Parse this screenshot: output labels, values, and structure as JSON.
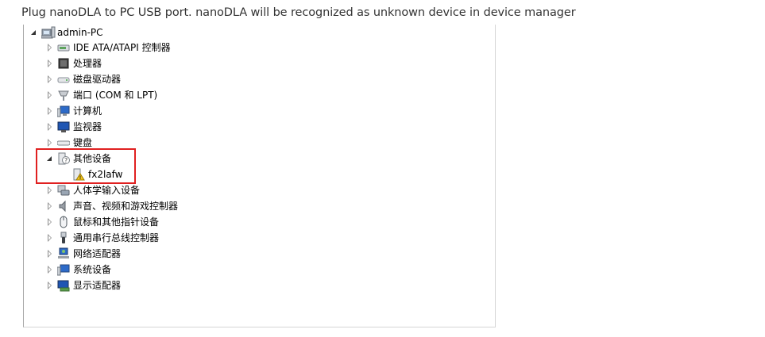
{
  "instruction": "Plug nanoDLA to PC USB port. nanoDLA will be recognized as unknown device in device manager",
  "tree": {
    "root": {
      "label": "admin-PC",
      "icon": "computer-icon"
    },
    "categories": [
      {
        "label": "IDE ATA/ATAPI 控制器",
        "icon": "ide-controller-icon"
      },
      {
        "label": "处理器",
        "icon": "processor-icon"
      },
      {
        "label": "磁盘驱动器",
        "icon": "disk-drive-icon"
      },
      {
        "label": "端口 (COM 和 LPT)",
        "icon": "port-icon"
      },
      {
        "label": "计算机",
        "icon": "computer-icon"
      },
      {
        "label": "监视器",
        "icon": "monitor-icon"
      },
      {
        "label": "键盘",
        "icon": "keyboard-icon"
      },
      {
        "label": "其他设备",
        "icon": "unknown-device-icon"
      },
      {
        "label": "人体学输入设备",
        "icon": "hid-icon"
      },
      {
        "label": "声音、视频和游戏控制器",
        "icon": "sound-icon"
      },
      {
        "label": "鼠标和其他指针设备",
        "icon": "mouse-icon"
      },
      {
        "label": "通用串行总线控制器",
        "icon": "usb-icon"
      },
      {
        "label": "网络适配器",
        "icon": "network-adapter-icon"
      },
      {
        "label": "系统设备",
        "icon": "system-device-icon"
      },
      {
        "label": "显示适配器",
        "icon": "display-adapter-icon"
      }
    ],
    "other_device_child": {
      "label": "fx2lafw",
      "icon": "warning-device-icon"
    }
  },
  "colors": {
    "highlight": "#e02020"
  }
}
